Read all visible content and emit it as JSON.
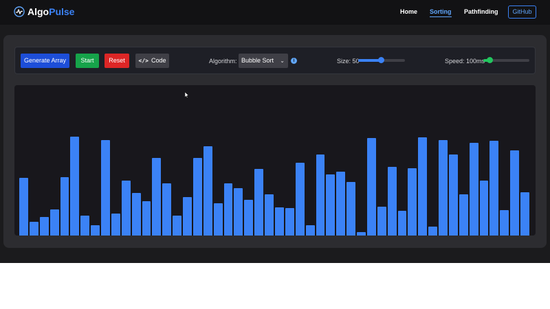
{
  "nav": {
    "logo_main": "Algo",
    "logo_accent": "Pulse",
    "links": [
      "Home",
      "Sorting",
      "Pathfinding"
    ],
    "github": "GitHub"
  },
  "toolbar": {
    "generate": "Generate Array",
    "start": "Start",
    "reset": "Reset",
    "code": "Code",
    "algorithm_label": "Algorithm:",
    "algorithm_value": "Bubble Sort",
    "size_label": "Size: 50",
    "size_value": 50,
    "speed_label": "Speed: 100ms",
    "speed_value_ms": 100
  },
  "icons": {
    "logo": "pulse-icon",
    "code": "code-icon",
    "info": "info-icon",
    "chevron": "chevron-down-icon"
  },
  "colors": {
    "bar": "#3b82f6",
    "generate": "#1d4ed8",
    "start": "#16a34a",
    "reset": "#dc2626",
    "accent": "#60a5fa"
  },
  "bars": [
    84,
    20,
    27,
    38,
    85,
    144,
    29,
    15,
    139,
    32,
    80,
    62,
    50,
    113,
    76,
    29,
    56,
    113,
    130,
    47,
    76,
    69,
    52,
    97,
    60,
    41,
    40,
    106,
    15,
    118,
    89,
    93,
    78,
    5,
    142,
    42,
    100,
    36,
    98,
    143,
    13,
    139,
    118,
    60,
    135,
    80,
    138,
    37,
    124,
    63
  ]
}
